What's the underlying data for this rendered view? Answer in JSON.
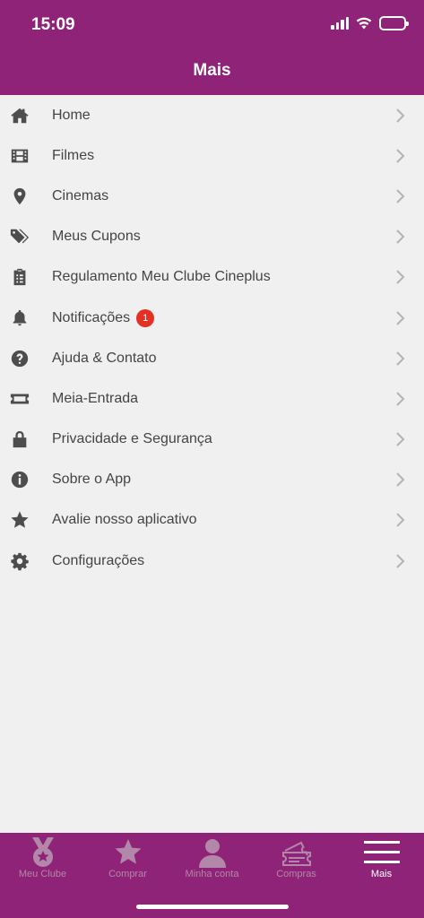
{
  "status": {
    "time": "15:09"
  },
  "header": {
    "title": "Mais"
  },
  "menu": [
    {
      "label": "Home",
      "icon": "home-icon"
    },
    {
      "label": "Filmes",
      "icon": "film-icon"
    },
    {
      "label": "Cinemas",
      "icon": "location-pin-icon"
    },
    {
      "label": "Meus Cupons",
      "icon": "tags-icon"
    },
    {
      "label": "Regulamento Meu Clube Cineplus",
      "icon": "clipboard-icon"
    },
    {
      "label": "Notificações",
      "icon": "bell-icon",
      "badge": "1"
    },
    {
      "label": "Ajuda & Contato",
      "icon": "question-circle-icon"
    },
    {
      "label": "Meia-Entrada",
      "icon": "ticket-icon"
    },
    {
      "label": "Privacidade e Segurança",
      "icon": "lock-icon"
    },
    {
      "label": "Sobre o App",
      "icon": "info-circle-icon"
    },
    {
      "label": "Avalie nosso aplicativo",
      "icon": "star-icon"
    },
    {
      "label": "Configurações",
      "icon": "gear-icon"
    }
  ],
  "tabbar": [
    {
      "label": "Meu Clube",
      "icon": "medal-icon",
      "active": false
    },
    {
      "label": "Comprar",
      "icon": "star-icon",
      "active": false
    },
    {
      "label": "Minha conta",
      "icon": "user-icon",
      "active": false
    },
    {
      "label": "Compras",
      "icon": "tickets-icon",
      "active": false
    },
    {
      "label": "Mais",
      "icon": "hamburger-menu-icon",
      "active": true
    }
  ],
  "colors": {
    "brand": "#8f2377",
    "badge": "#e53125",
    "background": "#f0f0f0",
    "tab_inactive": "#b387a9"
  }
}
